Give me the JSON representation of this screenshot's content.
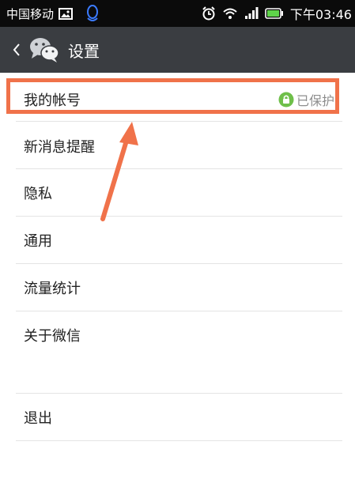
{
  "status_bar": {
    "carrier": "中国移动",
    "time": "下午03:46",
    "icons": [
      "image-icon",
      "qq-penguin-icon",
      "alarm-icon",
      "wifi-icon",
      "signal-icon",
      "battery-icon"
    ]
  },
  "header": {
    "back_icon": "chevron-left-icon",
    "logo_icon": "wechat-logo-icon",
    "title": "设置"
  },
  "settings": {
    "items": [
      {
        "label": "我的帐号",
        "badge": "已保护"
      },
      {
        "label": "新消息提醒"
      },
      {
        "label": "隐私"
      },
      {
        "label": "通用"
      },
      {
        "label": "流量统计"
      },
      {
        "label": "关于微信"
      }
    ],
    "logout": "退出"
  },
  "colors": {
    "status_bar_bg": "#0b0b0b",
    "title_bar_bg": "#3a3d41",
    "annotation": "#f0724a",
    "protected_green": "#6fbf4a"
  }
}
